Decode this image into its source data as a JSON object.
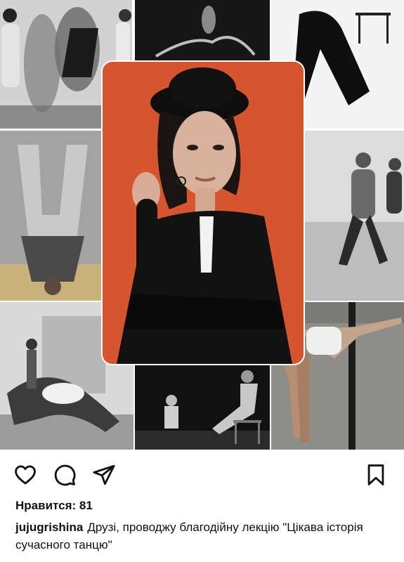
{
  "post": {
    "images": {
      "collage": [
        "dancers-shadow",
        "dancer-leap-dark",
        "dancer-bending-studio",
        "dancer-upside-down",
        "dancers-running",
        "dancers-group-floor",
        "dancers-stage-chair",
        "dancer-reaching"
      ],
      "portrait": "woman-black-hat-orange-backdrop"
    },
    "actions": {
      "like_icon": "heart-icon",
      "comment_icon": "comment-icon",
      "share_icon": "paper-plane-icon",
      "save_icon": "bookmark-icon"
    },
    "likes": {
      "label": "Нравится:",
      "count": "81"
    },
    "caption": {
      "username": "jujugrishina",
      "text": "Друзі, проводжу благодійну лекцію \"Цікава історія сучасного танцю\""
    }
  },
  "colors": {
    "portrait_background": "#d6552f",
    "text": "#111111"
  }
}
